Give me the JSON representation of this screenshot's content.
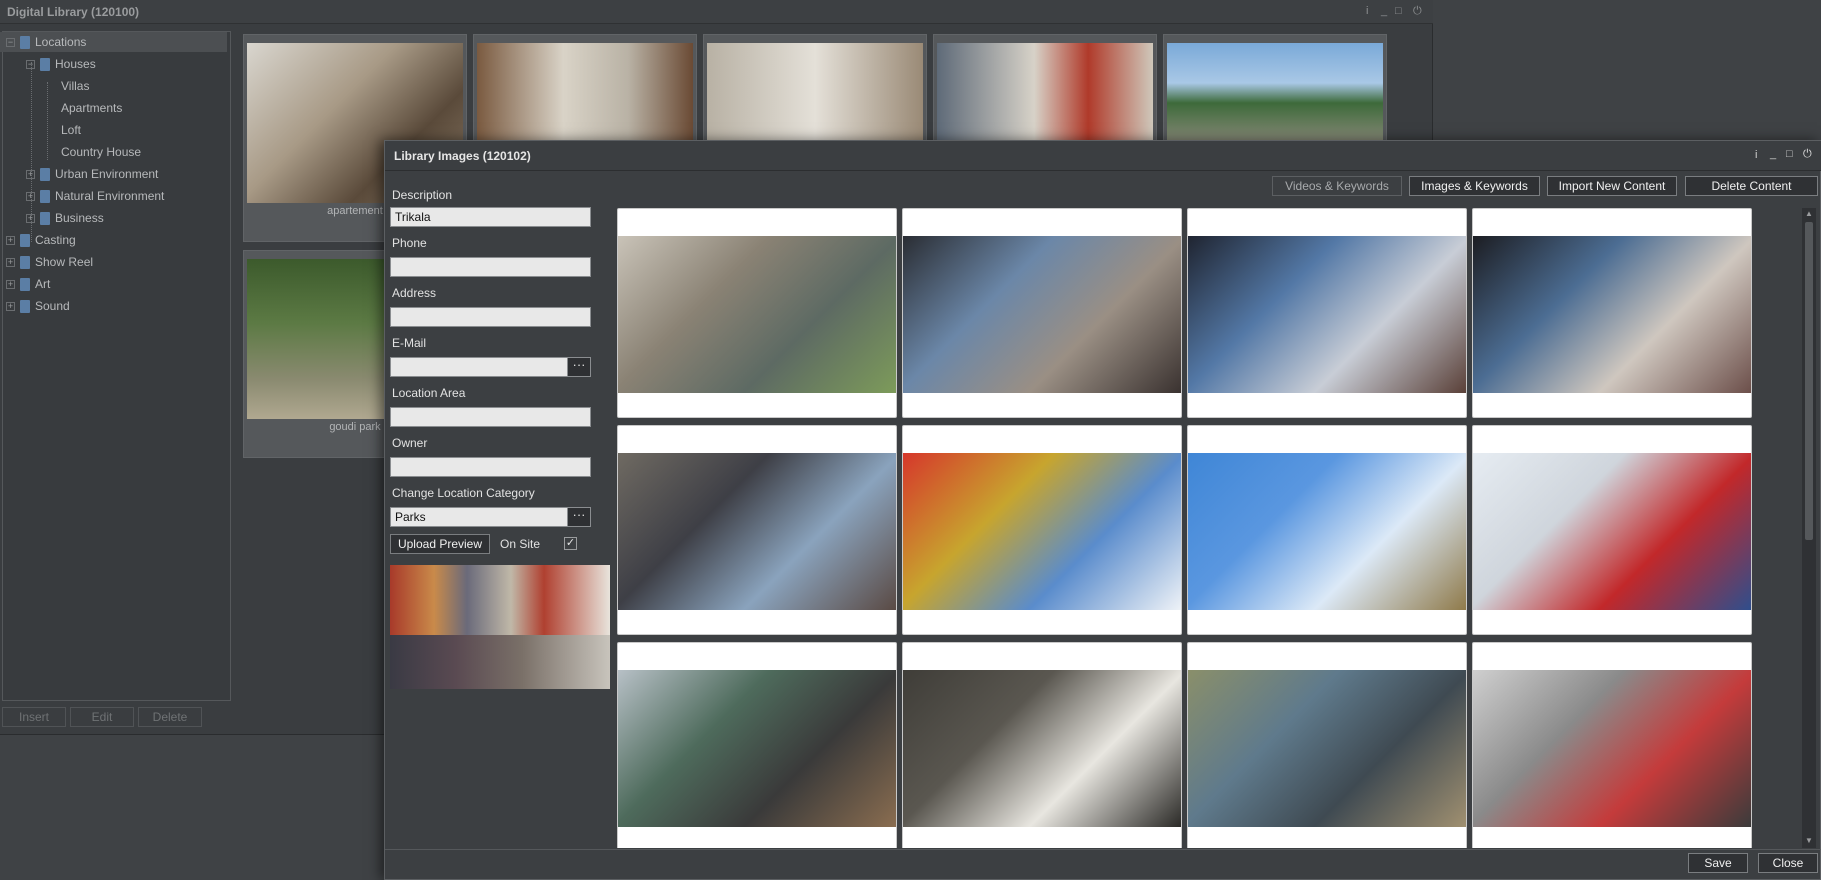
{
  "bg_window": {
    "title": "Digital Library (120100)",
    "controls": [
      "i",
      "_",
      "□",
      "⏻"
    ],
    "tree": [
      {
        "label": "Locations",
        "level": 0,
        "toggle": "⊟",
        "selected": true
      },
      {
        "label": "Houses",
        "level": 1,
        "toggle": "⊟"
      },
      {
        "label": "Villas",
        "level": 2
      },
      {
        "label": "Apartments",
        "level": 2
      },
      {
        "label": "Loft",
        "level": 2
      },
      {
        "label": "Country House",
        "level": 2
      },
      {
        "label": "Urban Environment",
        "level": 1,
        "toggle": "⊞"
      },
      {
        "label": "Natural Environment",
        "level": 1,
        "toggle": "⊞"
      },
      {
        "label": "Business",
        "level": 1,
        "toggle": "⊞"
      },
      {
        "label": "Casting",
        "level": 0,
        "toggle": "⊞"
      },
      {
        "label": "Show Reel",
        "level": 0,
        "toggle": "⊞"
      },
      {
        "label": "Art",
        "level": 0,
        "toggle": "⊞"
      },
      {
        "label": "Sound",
        "level": 0,
        "toggle": "⊞"
      }
    ],
    "buttons": {
      "insert": "Insert",
      "edit": "Edit",
      "delete": "Delete"
    },
    "thumb_captions": [
      "apartement",
      "goudi park"
    ]
  },
  "modal": {
    "title": "Library Images (120102)",
    "controls": [
      "i",
      "_",
      "□",
      "⏻"
    ],
    "toolbar": {
      "videos": "Videos & Keywords",
      "images": "Images & Keywords",
      "import": "Import New Content",
      "delete": "Delete Content"
    },
    "form": {
      "description_label": "Description",
      "description_value": "Trikala",
      "phone_label": "Phone",
      "phone_value": "",
      "address_label": "Address",
      "address_value": "",
      "email_label": "E-Mail",
      "email_value": "",
      "location_area_label": "Location Area",
      "location_area_value": "",
      "owner_label": "Owner",
      "owner_value": "",
      "category_label": "Change Location Category",
      "category_value": "Parks",
      "ellipsis": "···",
      "upload_preview": "Upload Preview",
      "on_site_label": "On Site",
      "on_site_checked": "✓"
    },
    "footer": {
      "save": "Save",
      "close": "Close"
    },
    "images": [
      {
        "name": "stream-weir",
        "colors": [
          "#c9c3b8",
          "#8a8274",
          "#5d6a63",
          "#7d9b5a"
        ]
      },
      {
        "name": "mushroom-figures",
        "colors": [
          "#2a2d33",
          "#6b87a8",
          "#9a8f84",
          "#3a3230"
        ]
      },
      {
        "name": "white-statue",
        "colors": [
          "#1f2430",
          "#5378a6",
          "#c8cdd6",
          "#5a4038"
        ]
      },
      {
        "name": "figures-display",
        "colors": [
          "#1c1d22",
          "#4c6d93",
          "#cfc7bf",
          "#6c4f4a"
        ]
      },
      {
        "name": "tiki-figures",
        "colors": [
          "#6f6a62",
          "#3e3f46",
          "#8aa3bd",
          "#5a4a44"
        ]
      },
      {
        "name": "fairground-ride",
        "colors": [
          "#d6372b",
          "#c7a52e",
          "#5a8ccc",
          "#eef2f7"
        ]
      },
      {
        "name": "sky-rooftop",
        "colors": [
          "#3f86d6",
          "#5a97e0",
          "#dce9f7",
          "#8f7a4a"
        ]
      },
      {
        "name": "painted-wall",
        "colors": [
          "#e6ecf2",
          "#cfd5dc",
          "#c2282a",
          "#2f4e8c"
        ]
      },
      {
        "name": "footbridge-park",
        "colors": [
          "#b7c0c6",
          "#4e6b5c",
          "#3a3a3a",
          "#8a6d50"
        ]
      },
      {
        "name": "ducks-pond",
        "colors": [
          "#3f3d38",
          "#5a5750",
          "#e8e6e0",
          "#2b2a27"
        ]
      },
      {
        "name": "marsh-water",
        "colors": [
          "#8a8f6a",
          "#5f7a8c",
          "#3f4a52",
          "#a09070"
        ]
      },
      {
        "name": "umbrella-alley",
        "colors": [
          "#cfcfcf",
          "#8a8a8a",
          "#c43b3b",
          "#3b3b3b"
        ]
      }
    ]
  }
}
